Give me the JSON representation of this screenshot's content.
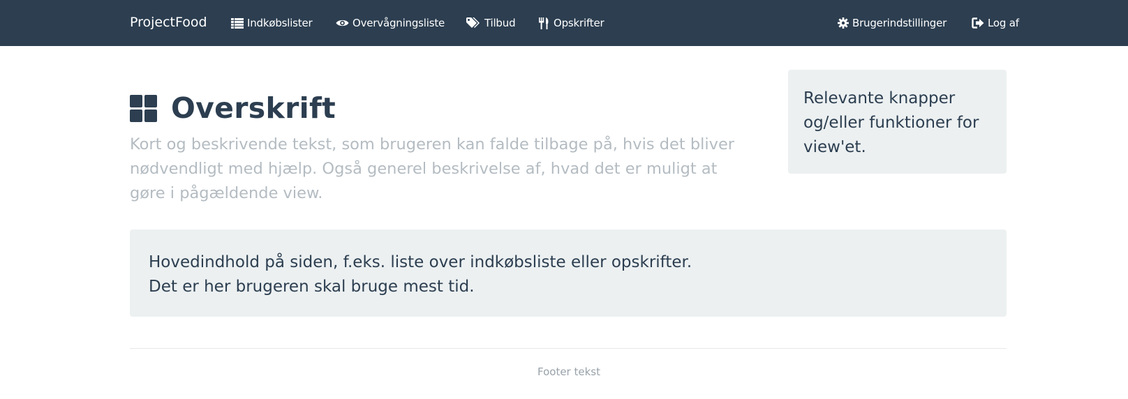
{
  "navbar": {
    "brand": "ProjectFood",
    "items": [
      {
        "label": "Indkøbslister",
        "icon": "list-icon"
      },
      {
        "label": "Overvågningsliste",
        "icon": "eye-icon"
      },
      {
        "label": "Tilbud",
        "icon": "tags-icon"
      },
      {
        "label": "Opskrifter",
        "icon": "cutlery-icon"
      }
    ],
    "right_items": [
      {
        "label": "Brugerindstillinger",
        "icon": "gear-icon"
      },
      {
        "label": "Log af",
        "icon": "log-out-icon"
      }
    ]
  },
  "header": {
    "icon": "dashboard-icon",
    "title": "Overskrift",
    "lead": "Kort og beskrivende tekst, som brugeren kan falde tilbage på, hvis det bliver nødvendligt med hjælp. Også generel beskrivelse af, hvad det er muligt at gøre i pågældende view."
  },
  "side_panel": {
    "text": "Relevante knapper og/eller funktioner for view'et."
  },
  "main_panel": {
    "line1": "Hovedindhold på siden, f.eks. liste over indkøbsliste eller opskrifter.",
    "line2": "Det er her brugeren skal bruge mest tid."
  },
  "footer": {
    "text": "Footer tekst"
  },
  "colors": {
    "navbar_bg": "#2c3e50",
    "well_bg": "#ecf0f1",
    "muted_text": "#b4bcc2"
  }
}
